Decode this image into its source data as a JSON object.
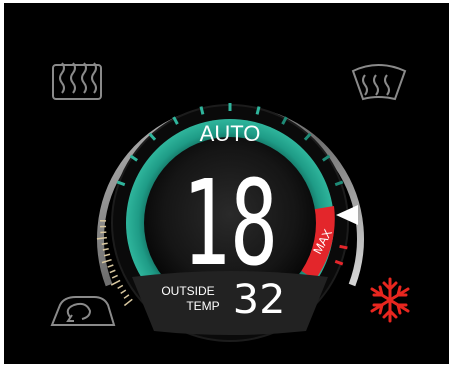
{
  "screen": {
    "mode_label": "AUTO",
    "set_temperature": "18",
    "outside_label_line1": "OUTSIDE",
    "outside_label_line2": "TEMP",
    "outside_temperature": "32",
    "max_label": "MAX",
    "fan_level_fraction": 0.8
  },
  "icons": {
    "rear_defrost": "rear-window-defrost-icon",
    "front_defrost": "windshield-defrost-icon",
    "recirculation": "air-recirculation-icon",
    "ac": "snowflake-ac-icon"
  },
  "colors": {
    "accent_teal": "#1e9b86",
    "max_red": "#e3262b",
    "snowflake_red": "#e8261f",
    "icon_gray": "#8a8a8a",
    "digit_white": "#ffffff"
  }
}
